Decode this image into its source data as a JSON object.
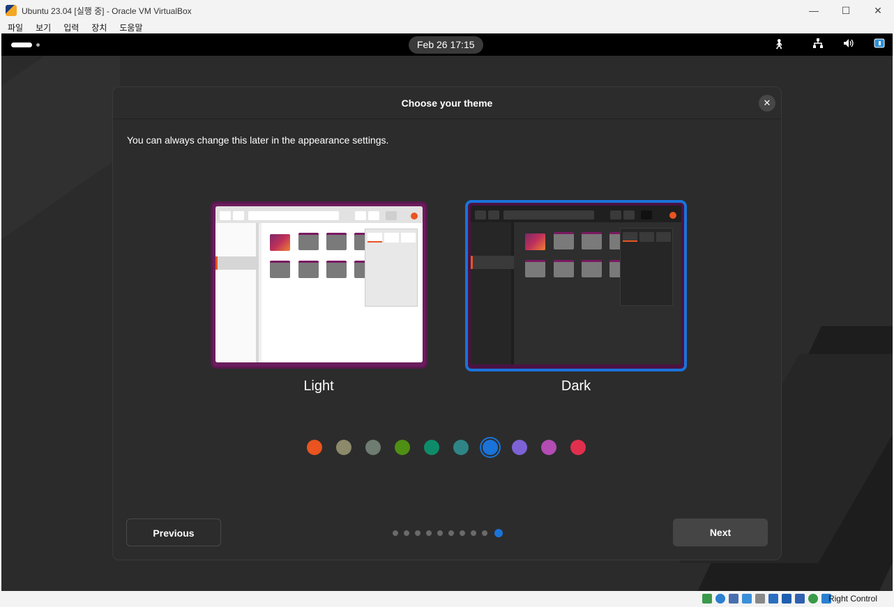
{
  "window": {
    "title": "Ubuntu 23.04 [실행 중] - Oracle VM VirtualBox",
    "minimize": "—",
    "maximize": "☐",
    "close": "✕"
  },
  "menubar": [
    "파일",
    "보기",
    "입력",
    "장치",
    "도움말"
  ],
  "topbar": {
    "clock": "Feb 26  17:15"
  },
  "dialog": {
    "title": "Choose your theme",
    "close": "✕",
    "description": "You can always change this later in the appearance settings.",
    "themes": [
      {
        "label": "Light",
        "selected": false
      },
      {
        "label": "Dark",
        "selected": true
      }
    ],
    "accent_colors": [
      "#e95420",
      "#8c8a6a",
      "#6f7c71",
      "#4f8f14",
      "#0e8c6a",
      "#2f8585",
      "#1a73d9",
      "#7d62d6",
      "#b34cb3",
      "#e0304e"
    ],
    "selected_accent": "#1a73d9",
    "previous_label": "Previous",
    "next_label": "Next",
    "page_count": 10,
    "current_page": 10
  },
  "statusbar": {
    "host_key": "Right Control"
  }
}
